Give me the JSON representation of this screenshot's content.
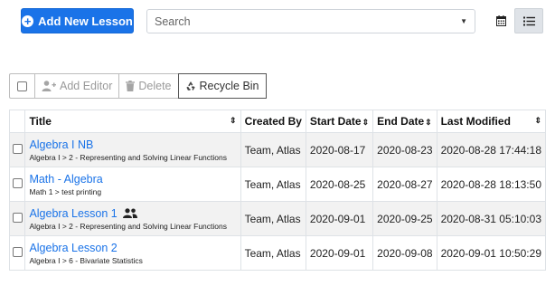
{
  "header": {
    "add_button_label": "Add New Lesson",
    "search_placeholder": "Search"
  },
  "toolbar": {
    "add_editor_label": "Add Editor",
    "delete_label": "Delete",
    "recycle_bin_label": "Recycle Bin"
  },
  "table": {
    "headers": [
      "Title",
      "Created By",
      "Start Date",
      "End Date",
      "Last Modified"
    ],
    "rows": [
      {
        "title": "Algebra I NB",
        "path": "Algebra I > 2 - Representing and Solving Linear Functions",
        "created_by": "Team, Atlas",
        "start": "2020-08-17",
        "end": "2020-08-23",
        "modified": "2020-08-28 17:44:18",
        "shared": false
      },
      {
        "title": "Math - Algebra",
        "path": "Math 1 > test printing",
        "created_by": "Team, Atlas",
        "start": "2020-08-25",
        "end": "2020-08-27",
        "modified": "2020-08-28 18:13:50",
        "shared": false
      },
      {
        "title": "Algebra Lesson 1",
        "path": "Algebra I > 2 - Representing and Solving Linear Functions",
        "created_by": "Team, Atlas",
        "start": "2020-09-01",
        "end": "2020-09-25",
        "modified": "2020-08-31 05:10:03",
        "shared": true
      },
      {
        "title": "Algebra Lesson 2",
        "path": "Algebra I > 6 - Bivariate Statistics",
        "created_by": "Team, Atlas",
        "start": "2020-09-01",
        "end": "2020-09-08",
        "modified": "2020-09-01 10:50:29",
        "shared": false
      }
    ]
  },
  "colors": {
    "primary": "#1a73e8",
    "link": "#1a73e8",
    "row_shade": "#f2f2f2"
  }
}
